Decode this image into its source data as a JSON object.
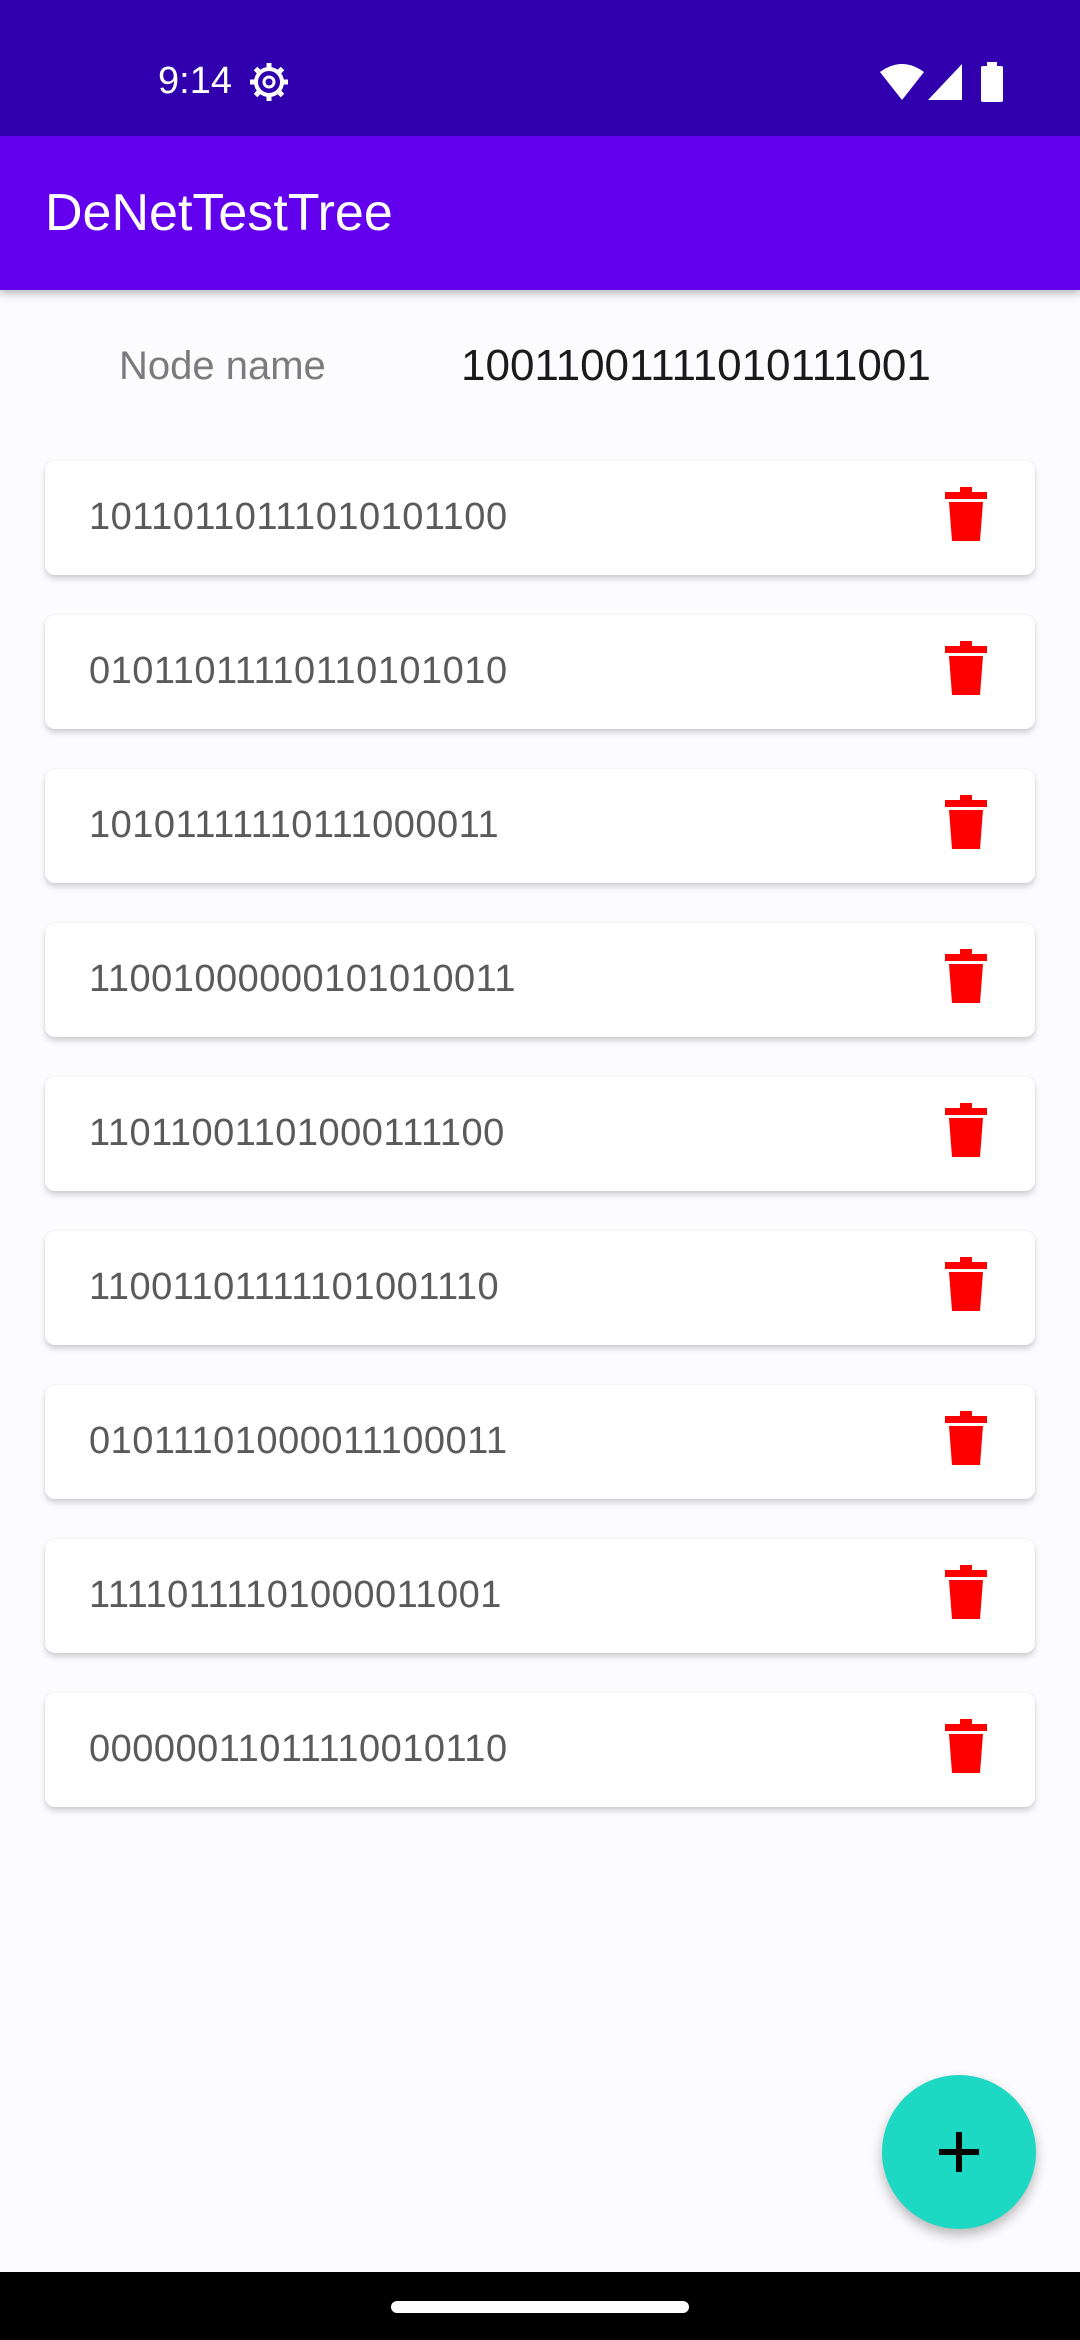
{
  "status_bar": {
    "time": "9:14",
    "icons": [
      "settings-gear-icon",
      "wifi-icon",
      "cellular-signal-icon",
      "battery-icon"
    ]
  },
  "app_bar": {
    "title": "DeNetTestTree"
  },
  "node_header": {
    "label": "Node name",
    "value": "10011001111010111001"
  },
  "nodes": [
    {
      "name": "10110110111010101100"
    },
    {
      "name": "01011011110110101010"
    },
    {
      "name": "10101111110111000011"
    },
    {
      "name": "11001000000101010011"
    },
    {
      "name": "11011001101000111100"
    },
    {
      "name": "11001101111101001110"
    },
    {
      "name": "01011101000011100011"
    },
    {
      "name": "11110111101000011001"
    },
    {
      "name": "00000011011110010110"
    }
  ],
  "colors": {
    "status_bar": "#3100AE",
    "app_bar": "#6200EE",
    "delete_icon": "#FF0000",
    "fab": "#1DD8C3"
  },
  "fab": {
    "icon": "plus-icon"
  }
}
